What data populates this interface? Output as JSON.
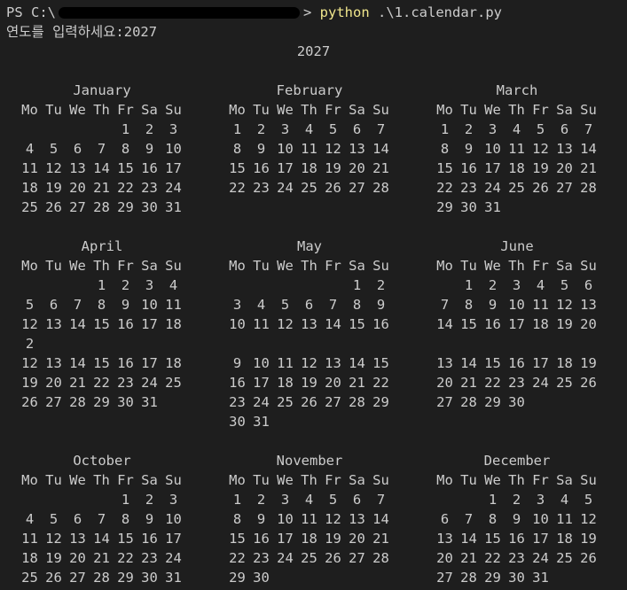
{
  "terminal": {
    "prompt": "PS C:\\",
    "command": "python",
    "arg": ".\\1.calendar.py",
    "input_prompt": "연도를 입력하세요:",
    "input_value": "2027",
    "year_title": "2027",
    "redaction_color": "#000000"
  },
  "months": [
    {
      "name": "January",
      "headers": [
        "Mo",
        "Tu",
        "We",
        "Th",
        "Fr",
        "Sa",
        "Su"
      ],
      "weeks": [
        [
          "",
          "",
          "",
          "",
          "1",
          "2",
          "3"
        ],
        [
          "4",
          "5",
          "6",
          "7",
          "8",
          "9",
          "10"
        ],
        [
          "11",
          "12",
          "13",
          "14",
          "15",
          "16",
          "17"
        ],
        [
          "18",
          "19",
          "20",
          "21",
          "22",
          "23",
          "24"
        ],
        [
          "25",
          "26",
          "27",
          "28",
          "29",
          "30",
          "31"
        ]
      ]
    },
    {
      "name": "February",
      "headers": [
        "Mo",
        "Tu",
        "We",
        "Th",
        "Fr",
        "Sa",
        "Su"
      ],
      "weeks": [
        [
          "1",
          "2",
          "3",
          "4",
          "5",
          "6",
          "7"
        ],
        [
          "8",
          "9",
          "10",
          "11",
          "12",
          "13",
          "14"
        ],
        [
          "15",
          "16",
          "17",
          "18",
          "19",
          "20",
          "21"
        ],
        [
          "22",
          "23",
          "24",
          "25",
          "26",
          "27",
          "28"
        ]
      ]
    },
    {
      "name": "March",
      "headers": [
        "Mo",
        "Tu",
        "We",
        "Th",
        "Fr",
        "Sa",
        "Su"
      ],
      "weeks": [
        [
          "1",
          "2",
          "3",
          "4",
          "5",
          "6",
          "7"
        ],
        [
          "8",
          "9",
          "10",
          "11",
          "12",
          "13",
          "14"
        ],
        [
          "15",
          "16",
          "17",
          "18",
          "19",
          "20",
          "21"
        ],
        [
          "22",
          "23",
          "24",
          "25",
          "26",
          "27",
          "28"
        ],
        [
          "29",
          "30",
          "31",
          "",
          "",
          "",
          ""
        ]
      ]
    },
    {
      "name": "April",
      "headers": [
        "Mo",
        "Tu",
        "We",
        "Th",
        "Fr",
        "Sa",
        "Su"
      ],
      "weeks": [
        [
          "",
          "",
          "",
          "1",
          "2",
          "3",
          "4"
        ],
        [
          "5",
          "6",
          "7",
          "8",
          "9",
          "10",
          "11"
        ],
        [
          "12",
          "13",
          "14",
          "15",
          "16",
          "17",
          "18"
        ],
        [
          "2",
          "",
          "",
          "",
          "",
          "",
          ""
        ],
        [
          "12",
          "13",
          "14",
          "15",
          "16",
          "17",
          "18"
        ],
        [
          "19",
          "20",
          "21",
          "22",
          "23",
          "24",
          "25"
        ],
        [
          "26",
          "27",
          "28",
          "29",
          "30",
          "31",
          ""
        ]
      ]
    },
    {
      "name": "May",
      "headers": [
        "Mo",
        "Tu",
        "We",
        "Th",
        "Fr",
        "Sa",
        "Su"
      ],
      "weeks": [
        [
          "",
          "",
          "",
          "",
          "",
          "1",
          "2"
        ],
        [
          "3",
          "4",
          "5",
          "6",
          "7",
          "8",
          "9"
        ],
        [
          "10",
          "11",
          "12",
          "13",
          "14",
          "15",
          "16"
        ],
        [
          "",
          "",
          "",
          "",
          "",
          "",
          ""
        ],
        [
          "9",
          "10",
          "11",
          "12",
          "13",
          "14",
          "15"
        ],
        [
          "16",
          "17",
          "18",
          "19",
          "20",
          "21",
          "22"
        ],
        [
          "23",
          "24",
          "25",
          "26",
          "27",
          "28",
          "29"
        ],
        [
          "30",
          "31",
          "",
          "",
          "",
          "",
          ""
        ]
      ]
    },
    {
      "name": "June",
      "headers": [
        "Mo",
        "Tu",
        "We",
        "Th",
        "Fr",
        "Sa",
        "Su"
      ],
      "weeks": [
        [
          "",
          "1",
          "2",
          "3",
          "4",
          "5",
          "6"
        ],
        [
          "7",
          "8",
          "9",
          "10",
          "11",
          "12",
          "13"
        ],
        [
          "14",
          "15",
          "16",
          "17",
          "18",
          "19",
          "20"
        ],
        [
          "",
          "",
          "",
          "",
          "",
          "",
          ""
        ],
        [
          "13",
          "14",
          "15",
          "16",
          "17",
          "18",
          "19"
        ],
        [
          "20",
          "21",
          "22",
          "23",
          "24",
          "25",
          "26"
        ],
        [
          "27",
          "28",
          "29",
          "30",
          "",
          "",
          ""
        ]
      ]
    },
    {
      "name": "October",
      "headers": [
        "Mo",
        "Tu",
        "We",
        "Th",
        "Fr",
        "Sa",
        "Su"
      ],
      "weeks": [
        [
          "",
          "",
          "",
          "",
          "1",
          "2",
          "3"
        ],
        [
          "4",
          "5",
          "6",
          "7",
          "8",
          "9",
          "10"
        ],
        [
          "11",
          "12",
          "13",
          "14",
          "15",
          "16",
          "17"
        ],
        [
          "18",
          "19",
          "20",
          "21",
          "22",
          "23",
          "24"
        ],
        [
          "25",
          "26",
          "27",
          "28",
          "29",
          "30",
          "31"
        ]
      ]
    },
    {
      "name": "November",
      "headers": [
        "Mo",
        "Tu",
        "We",
        "Th",
        "Fr",
        "Sa",
        "Su"
      ],
      "weeks": [
        [
          "1",
          "2",
          "3",
          "4",
          "5",
          "6",
          "7"
        ],
        [
          "8",
          "9",
          "10",
          "11",
          "12",
          "13",
          "14"
        ],
        [
          "15",
          "16",
          "17",
          "18",
          "19",
          "20",
          "21"
        ],
        [
          "22",
          "23",
          "24",
          "25",
          "26",
          "27",
          "28"
        ],
        [
          "29",
          "30",
          "",
          "",
          "",
          "",
          ""
        ]
      ]
    },
    {
      "name": "December",
      "headers": [
        "Mo",
        "Tu",
        "We",
        "Th",
        "Fr",
        "Sa",
        "Su"
      ],
      "weeks": [
        [
          "",
          "",
          "1",
          "2",
          "3",
          "4",
          "5"
        ],
        [
          "6",
          "7",
          "8",
          "9",
          "10",
          "11",
          "12"
        ],
        [
          "13",
          "14",
          "15",
          "16",
          "17",
          "18",
          "19"
        ],
        [
          "20",
          "21",
          "22",
          "23",
          "24",
          "25",
          "26"
        ],
        [
          "27",
          "28",
          "29",
          "30",
          "31",
          "",
          ""
        ]
      ]
    }
  ]
}
